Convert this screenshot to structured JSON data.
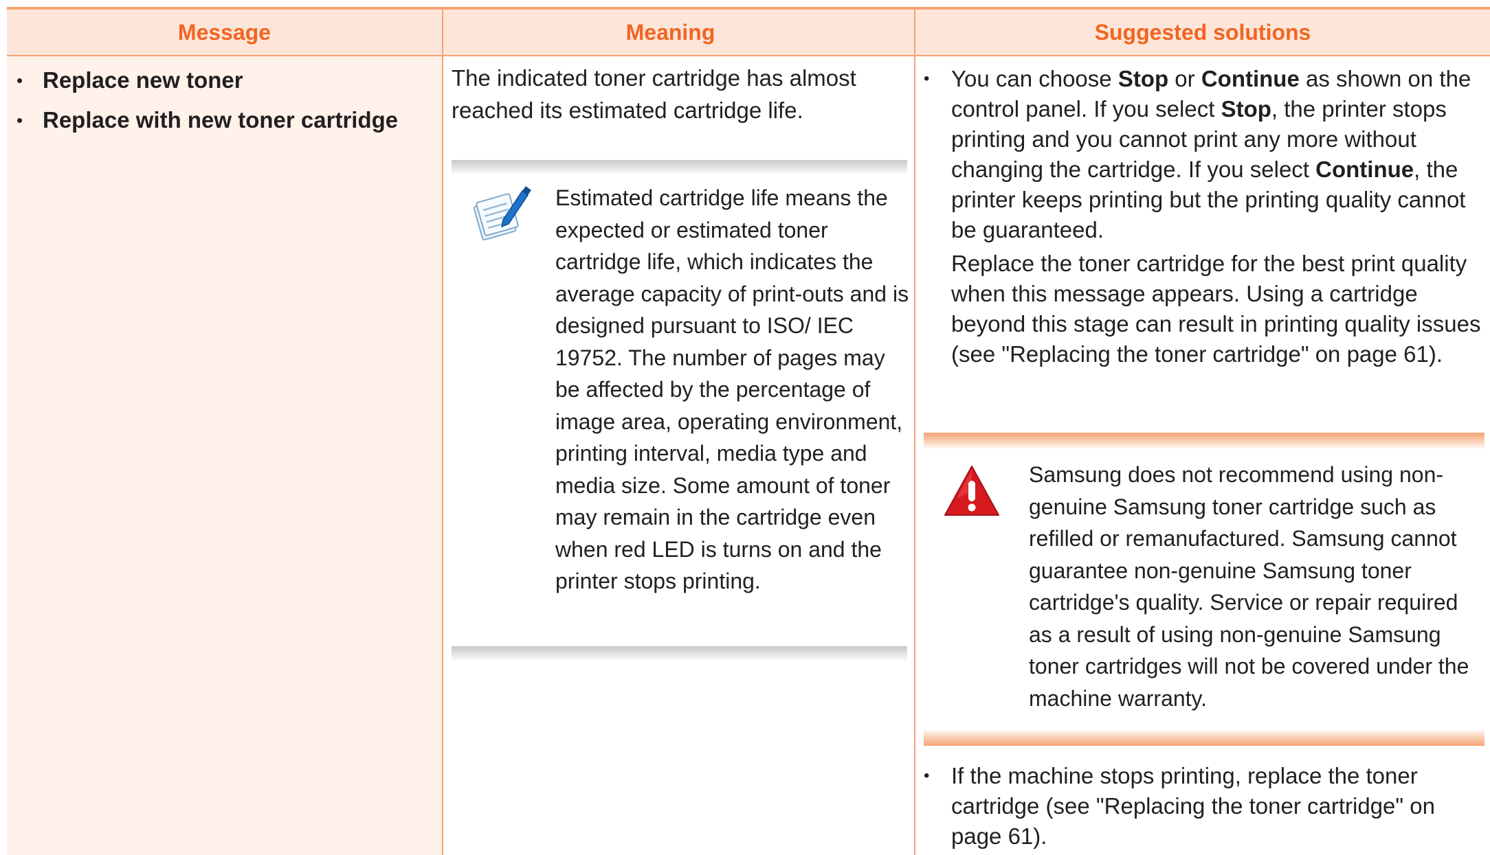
{
  "headers": {
    "message": "Message",
    "meaning": "Meaning",
    "solutions": "Suggested solutions"
  },
  "messages": [
    "Replace new toner",
    "Replace with new toner cartridge"
  ],
  "meaning": {
    "text": "The indicated toner cartridge has almost reached its estimated cartridge life.",
    "note": "Estimated cartridge life means the expected or estimated toner cartridge life, which indicates the average capacity of print-outs and is designed pursuant to ISO/ IEC 19752. The number of pages may be affected by the percentage of image area, operating environment, printing interval, media type and media size. Some amount of toner may remain in the cartridge even when red LED is turns on and the printer stops printing.",
    "note_icon": "note-pencil-icon"
  },
  "solutions": {
    "bullet": "•",
    "s1": {
      "t1": "You can choose ",
      "stop": "Stop",
      "t2": " or ",
      "continue": "Continue",
      "t3": " as shown on the control panel. If you select ",
      "stop2": "Stop",
      "t4": ", the printer stops printing and you cannot print any more without changing the cartridge. If you select ",
      "continue2": "Continue",
      "t5": ", the printer keeps printing but the printing quality cannot be guaranteed."
    },
    "s1b": "Replace the toner cartridge for the best print quality when this message appears. Using a cartridge beyond this stage can result in printing quality issues (see \"Replacing the toner cartridge\" on page 61).",
    "warning": "Samsung does not recommend using non-genuine Samsung toner cartridge such as refilled or remanufactured. Samsung cannot guarantee non-genuine Samsung toner cartridge's quality. Service or repair required as a result of using non-genuine Samsung toner cartridges will not be covered under the machine warranty.",
    "warning_icon": "warning-triangle-icon",
    "s2": "If the machine stops printing, replace the toner cartridge (see \"Replacing the toner cartridge\" on page 61)."
  },
  "colors": {
    "accent": "#f26522",
    "header_bg": "#fde6d9",
    "rule": "#f4a274",
    "col1_bg": "#fff2ea",
    "warning_red": "#d71920"
  }
}
